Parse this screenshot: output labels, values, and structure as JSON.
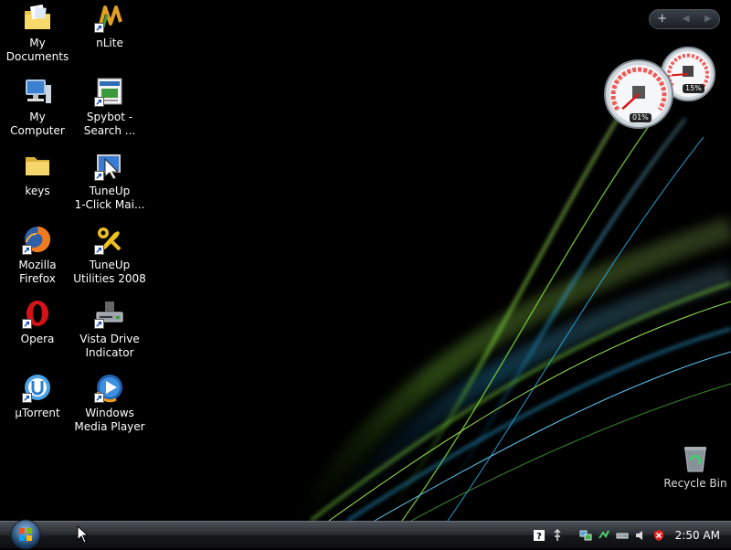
{
  "desktop": {
    "icons": [
      {
        "label": "My\nDocuments",
        "icon": "my-documents-folder-icon"
      },
      {
        "label": "My Computer",
        "icon": "my-computer-icon"
      },
      {
        "label": "keys",
        "icon": "folder-icon"
      },
      {
        "label": "Mozilla Firefox",
        "icon": "firefox-icon"
      },
      {
        "label": "Opera",
        "icon": "opera-icon"
      },
      {
        "label": "µTorrent",
        "icon": "utorrent-icon"
      },
      {
        "label": "nLite",
        "icon": "nlite-icon"
      },
      {
        "label": "Spybot -\nSearch ...",
        "icon": "spybot-icon"
      },
      {
        "label": "TuneUp\n1-Click Mai...",
        "icon": "tuneup-oneclick-icon"
      },
      {
        "label": "TuneUp\nUtilities 2008",
        "icon": "tuneup-utilities-icon"
      },
      {
        "label": "Vista Drive\nIndicator",
        "icon": "drive-indicator-icon"
      },
      {
        "label": "Windows\nMedia Player",
        "icon": "media-player-icon"
      }
    ],
    "recycle_bin": {
      "label": "Recycle Bin",
      "icon": "recycle-bin-icon"
    }
  },
  "sidebar": {
    "add_label": "+",
    "prev_label": "◀",
    "next_label": "▶"
  },
  "gadgets": {
    "cpu_meter": {
      "cpu_readout": "01%",
      "cpu_value": 1,
      "memory_readout": "15%",
      "memory_value": 15
    }
  },
  "taskbar": {
    "clock": "2:50 AM",
    "tray_icons": [
      "help-icon",
      "usb-icon",
      "network-icon",
      "volume-icon",
      "security-shield-icon"
    ]
  },
  "colors": {
    "wallpaper_green": "#7cd13a",
    "wallpaper_blue": "#2aa4d8",
    "taskbar_top": "#4c5157",
    "taskbar_bottom": "#0d0f12"
  }
}
